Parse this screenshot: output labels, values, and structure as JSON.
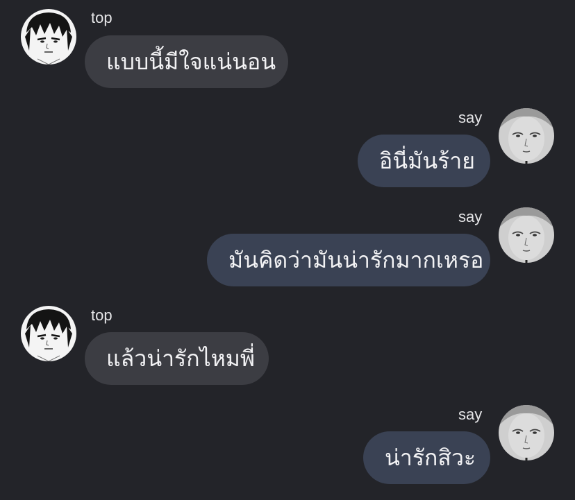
{
  "messages": [
    {
      "sender": "top",
      "text": "แบบนี้มีใจแน่นอน"
    },
    {
      "sender": "say",
      "text": "อินี่มันร้าย"
    },
    {
      "sender": "say",
      "text": "มันคิดว่ามันน่ารักมากเหรอ"
    },
    {
      "sender": "top",
      "text": "แล้วน่ารักไหมพี่"
    },
    {
      "sender": "say",
      "text": "น่ารักสิวะ"
    }
  ]
}
